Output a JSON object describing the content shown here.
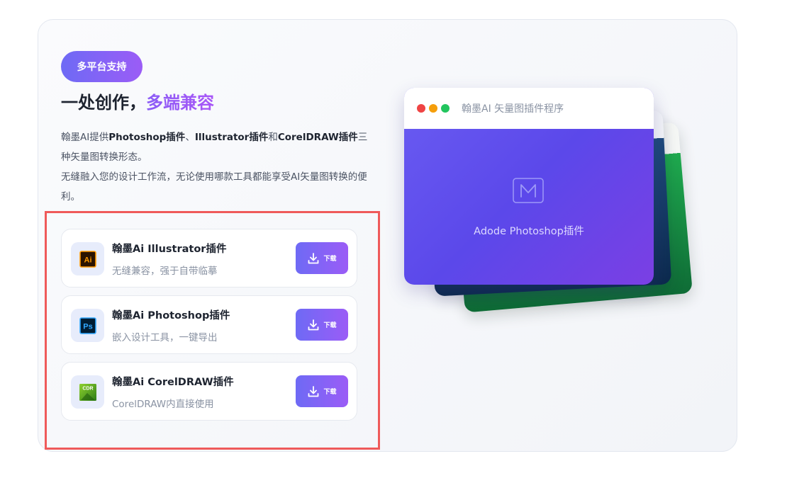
{
  "badge": "多平台支持",
  "heading": {
    "main": "一处创作，",
    "accent": "多端兼容"
  },
  "description": {
    "p1": [
      {
        "t": "翰墨AI提供",
        "b": false
      },
      {
        "t": "Photoshop插件",
        "b": true
      },
      {
        "t": "、",
        "b": false
      },
      {
        "t": "Illustrator插件",
        "b": true
      },
      {
        "t": "和",
        "b": false
      },
      {
        "t": "CorelDRAW插件",
        "b": true
      },
      {
        "t": "三种矢量图转换形态。",
        "b": false
      }
    ],
    "p2": "无缝融入您的设计工作流，无论使用哪款工具都能享受AI矢量图转换的便利。"
  },
  "plugins": [
    {
      "name": "翰墨Ai Illustrator插件",
      "desc": "无缝兼容，强于自带临摹",
      "icon_label": "Ai",
      "icon": "illustrator-icon",
      "download_label": "下载"
    },
    {
      "name": "翰墨Ai Photoshop插件",
      "desc": "嵌入设计工具，一键导出",
      "icon_label": "Ps",
      "icon": "photoshop-icon",
      "download_label": "下载"
    },
    {
      "name": "翰墨Ai CorelDRAW插件",
      "desc": "CorelDRAW内直接使用",
      "icon_label": "CDR",
      "icon": "coreldraw-icon",
      "download_label": "下载"
    }
  ],
  "preview": {
    "window_title": "翰墨AI 矢量图插件程序",
    "caption": "Adode Photoshop插件"
  },
  "colors": {
    "accent_start": "#6e6af5",
    "accent_end": "#9b5cf6",
    "highlight": "#ef5a5a",
    "dot_red": "#ef4444",
    "dot_yellow": "#f59e0b",
    "dot_green": "#22c55e"
  }
}
